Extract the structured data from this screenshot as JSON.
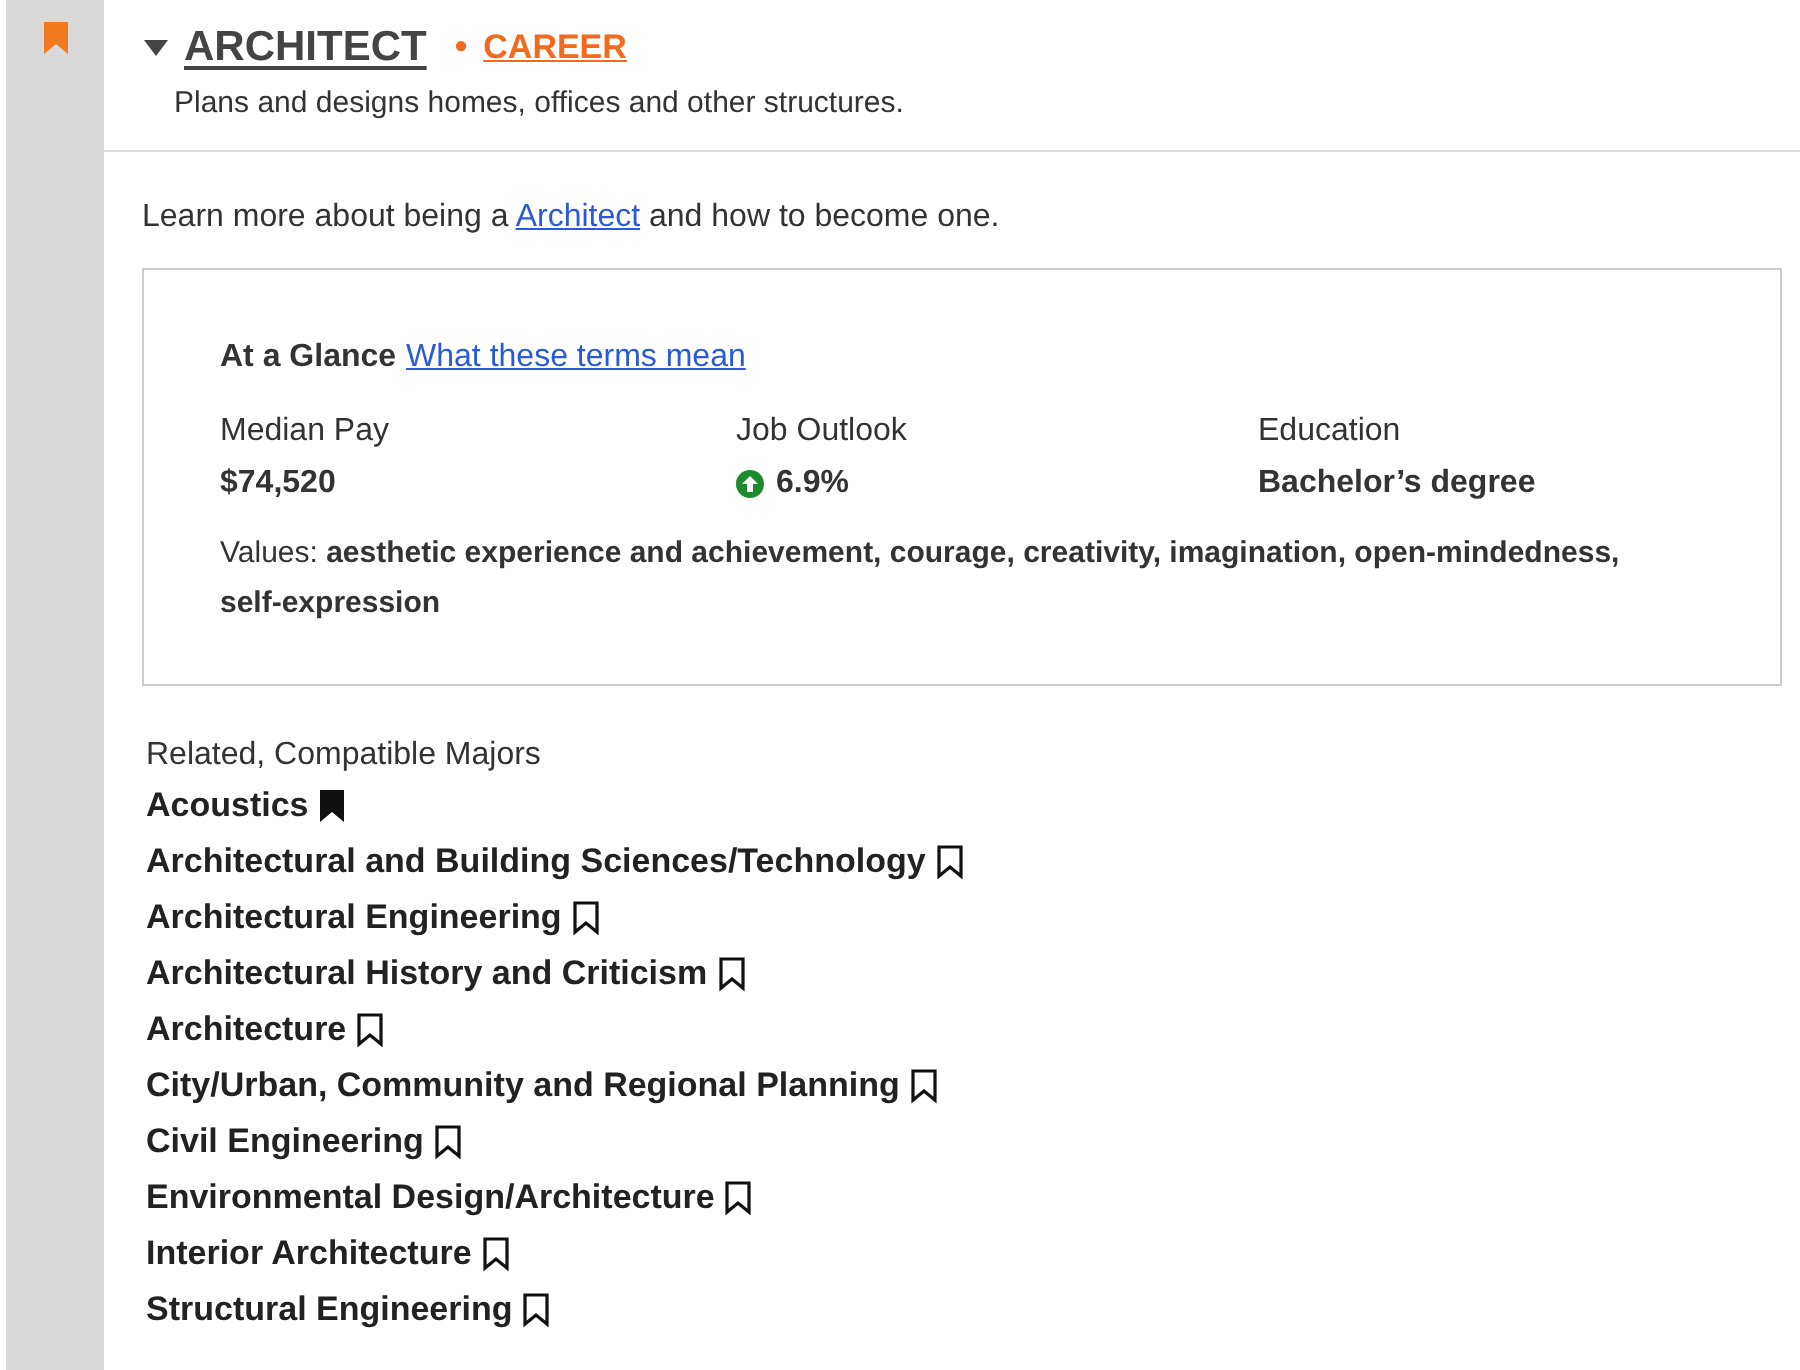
{
  "sidebar": {
    "bookmarked": true
  },
  "career": {
    "expanded": true,
    "title": "ARCHITECT",
    "bullet": "•",
    "category": "CAREER",
    "description": "Plans and designs homes, offices and other structures."
  },
  "learn_more": {
    "before": "Learn more about being a",
    "link": "Architect",
    "after": "and how to become one."
  },
  "glance": {
    "heading": "At a Glance",
    "link": "What these terms mean",
    "stats": [
      {
        "kind": "plain",
        "label": "Median Pay",
        "value": "$74,520"
      },
      {
        "kind": "rising",
        "label": "Job Outlook",
        "value": "6.9%"
      },
      {
        "kind": "plain",
        "label": "Education",
        "value": "Bachelor’s degree"
      }
    ],
    "values": "Values: **aesthetic experience and achievement, courage, creativity, imagination, open-mindedness, self-expression**"
  },
  "majors": {
    "heading": "Related, Compatible Majors",
    "items": [
      {
        "name": "Acoustics",
        "bookmarked": true
      },
      {
        "name": "Architectural and Building Sciences/Technology",
        "bookmarked": false
      },
      {
        "name": "Architectural Engineering",
        "bookmarked": false
      },
      {
        "name": "Architectural History and Criticism",
        "bookmarked": false
      },
      {
        "name": "Architecture",
        "bookmarked": false
      },
      {
        "name": "City/Urban, Community and Regional Planning",
        "bookmarked": false
      },
      {
        "name": "Civil Engineering",
        "bookmarked": false
      },
      {
        "name": "Environmental Design/Architecture",
        "bookmarked": false
      },
      {
        "name": "Interior Architecture",
        "bookmarked": false
      },
      {
        "name": "Structural Engineering",
        "bookmarked": false
      }
    ]
  }
}
